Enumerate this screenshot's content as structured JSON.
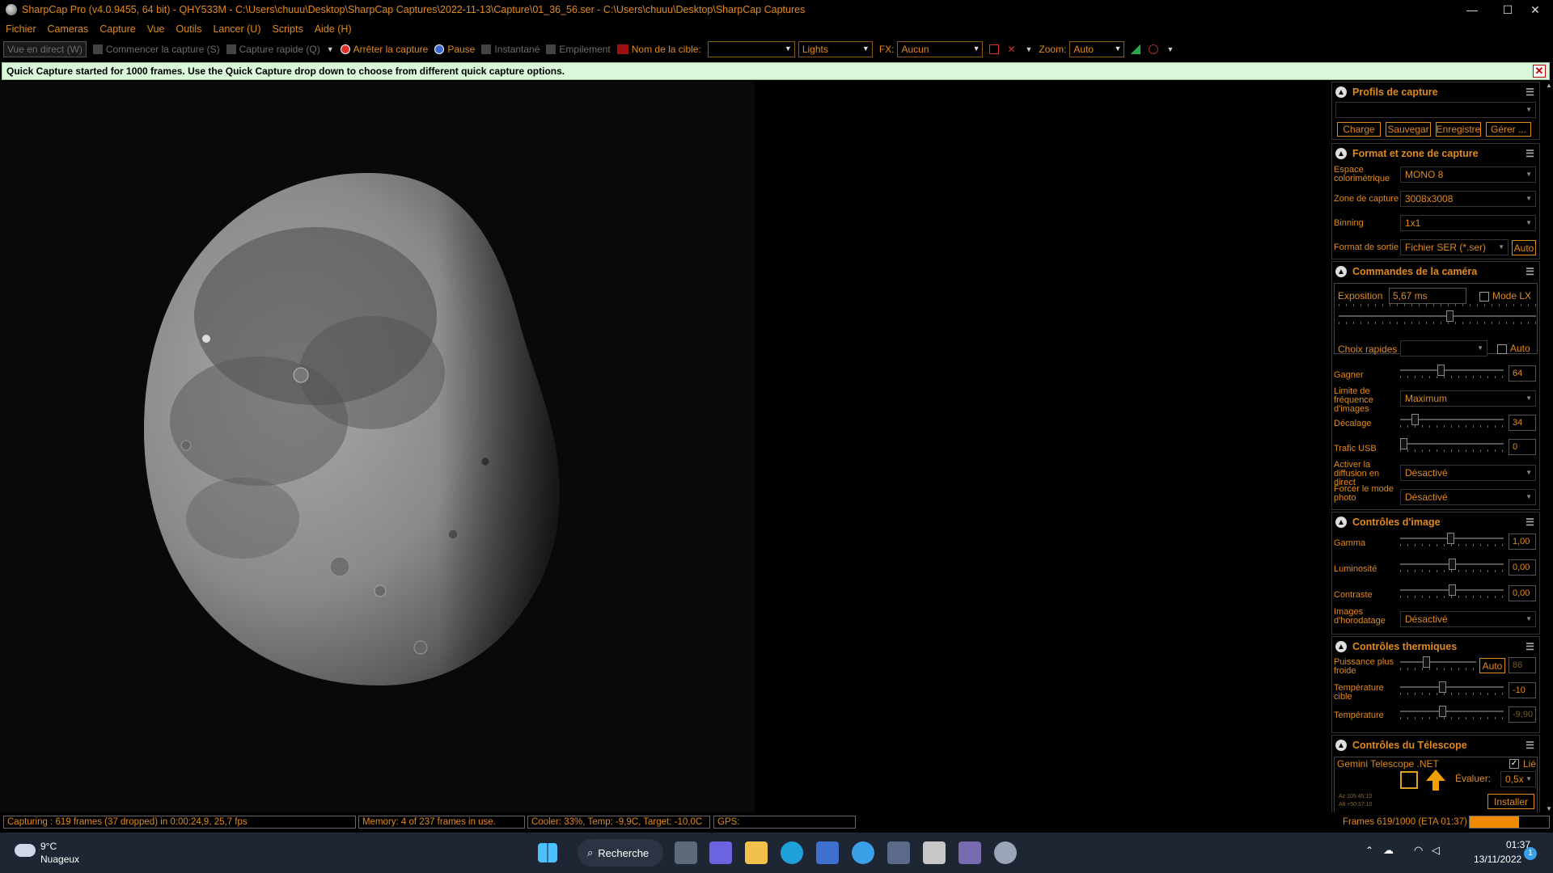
{
  "window": {
    "title": "SharpCap Pro (v4.0.9455, 64 bit) - QHY533M - C:\\Users\\chuuu\\Desktop\\SharpCap Captures\\2022-11-13\\Capture\\01_36_56.ser - C:\\Users\\chuuu\\Desktop\\SharpCap Captures",
    "minimize": "—",
    "maximize": "☐",
    "close": "✕"
  },
  "menu": [
    "Fichier",
    "Cameras",
    "Capture",
    "Vue",
    "Outils",
    "Lancer (U)",
    "Scripts",
    "Aide (H)"
  ],
  "toolbar": {
    "live_view": "Vue en direct (W)",
    "start_capture": "Commencer la capture (S)",
    "quick_capture": "Capture rapide (Q)",
    "stop_capture": "Arrêter la capture",
    "pause": "Pause",
    "snapshot": "Instantané",
    "stacking": "Empilement",
    "target_name_label": "Nom de la cible:",
    "target_name_value": "",
    "frame_type": "Lights",
    "fx_label": "FX:",
    "fx_value": "Aucun",
    "zoom_label": "Zoom:",
    "zoom_value": "Auto"
  },
  "notification": {
    "text": "Quick Capture started for 1000 frames. Use the Quick Capture drop down to choose from different quick capture options.",
    "close": "✕"
  },
  "panel": {
    "profiles": {
      "title": "Profils de capture",
      "selected": "",
      "buttons": [
        "Charge",
        "Sauvegar",
        "Enregistre",
        "Gérer ..."
      ]
    },
    "format": {
      "title": "Format et zone de capture",
      "color_space_label": "Espace colorimétrique",
      "color_space": "MONO 8",
      "area_label": "Zone de capture",
      "area": "3008x3008",
      "binning_label": "Binning",
      "binning": "1x1",
      "output_label": "Format de sortie",
      "output": "Fichier SER (*.ser)",
      "auto": "Auto"
    },
    "camera": {
      "title": "Commandes de la caméra",
      "exposure_label": "Exposition",
      "exposure": "5,67 ms",
      "lx_label": "Mode LX",
      "quick_label": "Choix rapides",
      "quick_value": "",
      "quick_auto": "Auto",
      "gain_label": "Gagner",
      "gain": "64",
      "fps_label": "Limite de fréquence d'images",
      "fps": "Maximum",
      "offset_label": "Décalage",
      "offset": "34",
      "usb_label": "Trafic USB",
      "usb": "0",
      "stream_label": "Activer la diffusion en direct",
      "stream": "Désactivé",
      "force_label": "Forcer le mode photo",
      "force": "Désactivé"
    },
    "image": {
      "title": "Contrôles d'image",
      "gamma_label": "Gamma",
      "gamma": "1,00",
      "brightness_label": "Luminosité",
      "brightness": "0,00",
      "contrast_label": "Contraste",
      "contrast": "0,00",
      "timestamp_label": "Images d'horodatage",
      "timestamp": "Désactivé"
    },
    "thermal": {
      "title": "Contrôles thermiques",
      "cooler_label": "Puissance plus froide",
      "cooler_auto": "Auto",
      "cooler": "86",
      "target_label": "Température cible",
      "target": "-10",
      "temp_label": "Température",
      "temp": "-9,90"
    },
    "telescope": {
      "title": "Contrôles du Télescope",
      "driver": "Gemini Telescope .NET",
      "linked_label": "Lié",
      "rate_label": "Évaluer:",
      "rate": "0,5x",
      "install": "Installer",
      "az": "Az  105:45:10",
      "alt": "Alt  +50:37:10"
    }
  },
  "status": {
    "capturing": "Capturing : 619 frames (37 dropped) in 0:00:24,9, 25,7 fps",
    "memory": "Memory: 4 of 237 frames in use.",
    "cooler": "Cooler: 33%, Temp: -9,9C, Target: -10,0C",
    "gps": "GPS:",
    "frames": "Frames 619/1000 (ETA 01:37)",
    "progress": 0.619
  },
  "taskbar": {
    "weather_temp": "9°C",
    "weather_desc": "Nuageux",
    "search": "Recherche",
    "time": "01:37",
    "date": "13/11/2022",
    "notifications": "1"
  },
  "colors": {
    "accent": "#e08a1e",
    "notify_bg": "#d9f7d9",
    "progress": "#f08a00",
    "taskbar": "#1f2633"
  }
}
